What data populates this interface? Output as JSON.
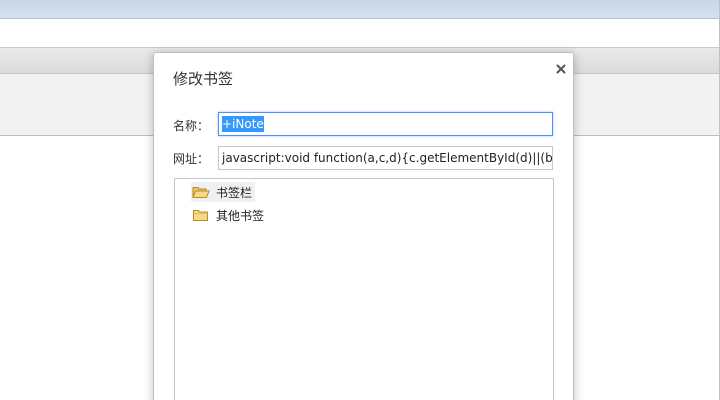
{
  "dialog": {
    "title": "修改书签",
    "name_label": "名称：",
    "url_label": "网址：",
    "name_value": "+iNote",
    "url_value": "javascript:void function(a,c,d){c.getElementById(d)||(b=c.c"
  },
  "folders": [
    {
      "label": "书签栏",
      "icon": "folder-open-icon",
      "selected": true
    },
    {
      "label": "其他书签",
      "icon": "folder-icon",
      "selected": false
    }
  ],
  "colors": {
    "focus_border": "#4d90fe",
    "selection": "#3399ff",
    "folder_fill": "#f6d98a"
  }
}
